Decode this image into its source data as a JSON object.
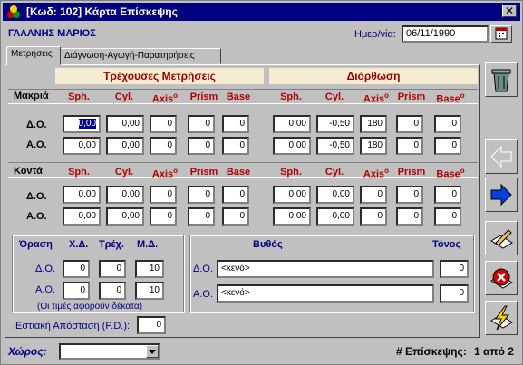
{
  "window": {
    "title": "[Κωδ: 102] Κάρτα Επίσκεψης",
    "close": "✕"
  },
  "patient": {
    "name": "ΓΑΛΑΝΗΣ ΜΑΡΙΟΣ"
  },
  "date": {
    "label": "Ημερ/νία:",
    "value": "06/11/1990"
  },
  "tabs": [
    {
      "label": "Μετρήσεις",
      "active": true
    },
    {
      "label": "Διάγνωση-Αγωγή-Παρατηρήσεις",
      "active": false
    }
  ],
  "sections": {
    "current": "Τρέχουσες Μετρήσεις",
    "correction": "Διόρθωση"
  },
  "columns": [
    "Sph.",
    "Cyl.",
    "Axis",
    "Prism",
    "Base"
  ],
  "degree_mark": "o",
  "rows": {
    "far": "Μακριά",
    "near": "Κοντά"
  },
  "eyes": {
    "right": "Δ.Ο.",
    "left": "Α.Ο."
  },
  "far": {
    "current": {
      "right": [
        "0,00",
        "0,00",
        "0",
        "0",
        "0"
      ],
      "left": [
        "0,00",
        "0,00",
        "0",
        "0",
        "0"
      ]
    },
    "correction": {
      "right": [
        "0,00",
        "-0,50",
        "180",
        "0",
        "0"
      ],
      "left": [
        "0,00",
        "-0,50",
        "180",
        "0",
        "0"
      ]
    }
  },
  "near": {
    "current": {
      "right": [
        "0,00",
        "0,00",
        "0",
        "0",
        "0"
      ],
      "left": [
        "0,00",
        "0,00",
        "0",
        "0",
        "0"
      ]
    },
    "correction": {
      "right": [
        "0,00",
        "0,00",
        "0",
        "0",
        "0"
      ],
      "left": [
        "0,00",
        "0,00",
        "0",
        "0",
        "0"
      ]
    }
  },
  "vision": {
    "title": "Όραση",
    "cols": [
      "Χ.Δ.",
      "Τρέχ.",
      "Μ.Δ."
    ],
    "right": [
      "0",
      "0",
      "10"
    ],
    "left": [
      "0",
      "0",
      "10"
    ],
    "note": "(Οι τιμές αφορούν δέκατα)"
  },
  "depth": {
    "title": "Βυθός",
    "tone": "Τόνος",
    "right": {
      "value": "<κενό>",
      "tone": "0"
    },
    "left": {
      "value": "<κενό>",
      "tone": "0"
    }
  },
  "pd": {
    "label": "Εστιακή Απόσταση (P.D.):",
    "value": "0"
  },
  "room": {
    "label": "Χώρος:",
    "value": ""
  },
  "visit": {
    "label": "# Επίσκεψης:",
    "value": "1 από 2"
  },
  "icons": [
    "delete-trash-icon",
    "previous-arrow-icon",
    "next-arrow-icon",
    "edit-pencil-icon",
    "cancel-x-icon",
    "save-lightning-icon"
  ]
}
